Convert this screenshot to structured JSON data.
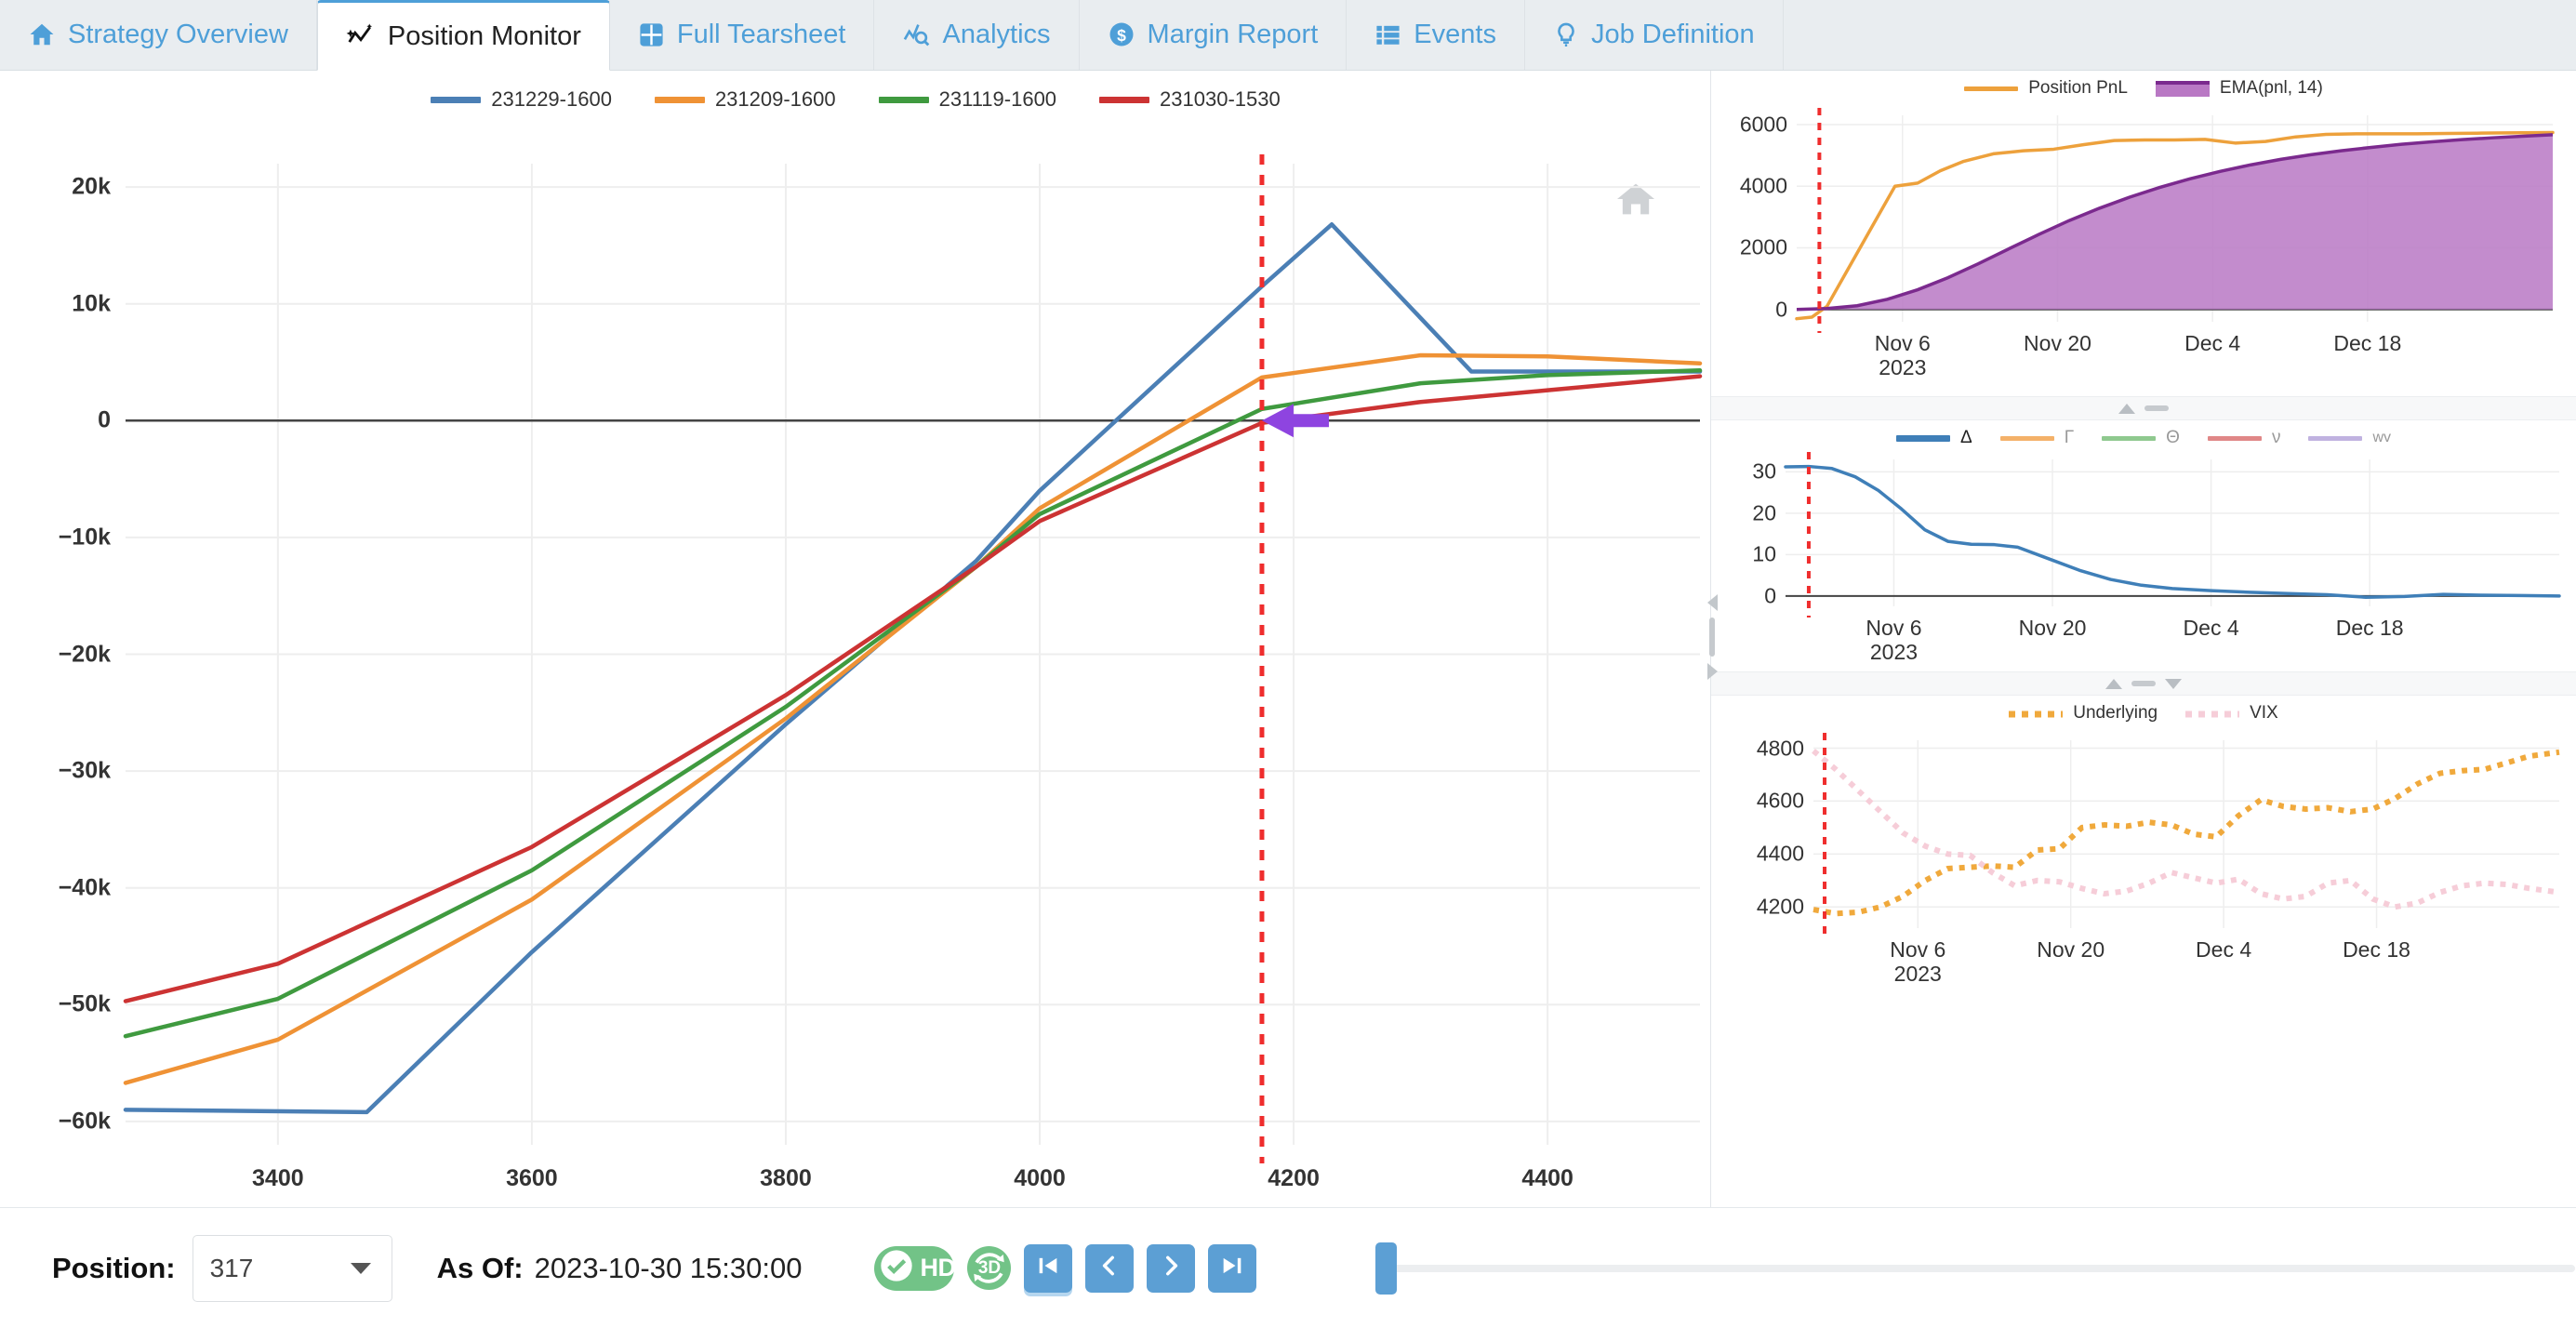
{
  "tabs": [
    {
      "label": "Strategy Overview",
      "icon": "home-icon",
      "active": false
    },
    {
      "label": "Position Monitor",
      "icon": "trend-sparkle-icon",
      "active": true
    },
    {
      "label": "Full Tearsheet",
      "icon": "grid-icon",
      "active": false
    },
    {
      "label": "Analytics",
      "icon": "analytics-magnify-icon",
      "active": false
    },
    {
      "label": "Margin Report",
      "icon": "dollar-circle-icon",
      "active": false
    },
    {
      "label": "Events",
      "icon": "list-icon",
      "active": false
    },
    {
      "label": "Job Definition",
      "icon": "lightbulb-icon",
      "active": false
    }
  ],
  "colors": {
    "tab_blue": "#4e9fd8",
    "series_blue": "#4b7fb5",
    "series_orange": "#ef9235",
    "series_green": "#3f9a3f",
    "series_red": "#cc3333",
    "marker_red": "#ef2d2d",
    "arrow_purple": "#8e44e0",
    "pnl_orange": "#eda13c",
    "ema_purple_fill": "#b978c4",
    "ema_purple_line": "#7b2a8e",
    "greek_delta": "#3f7fb8",
    "greek_gamma": "#f4b169",
    "greek_theta": "#8fc98f",
    "greek_vega": "#e08787",
    "greek_wv": "#c0b2e0",
    "underlying_orange": "#f0a93c",
    "vix_pink": "#f6cdd8",
    "green_toggle": "#72c387",
    "nav_blue": "#5c9fd4"
  },
  "main_chart": {
    "home_icon": "home-reset-icon",
    "legend": [
      {
        "label": "231229-1600",
        "color": "#4b7fb5"
      },
      {
        "label": "231209-1600",
        "color": "#ef9235"
      },
      {
        "label": "231119-1600",
        "color": "#3f9a3f"
      },
      {
        "label": "231030-1530",
        "color": "#cc3333"
      }
    ],
    "chart_data": {
      "type": "line",
      "title": "",
      "xlabel": "",
      "ylabel": "",
      "xlim": [
        3280,
        4520
      ],
      "ylim": [
        -62000,
        22000
      ],
      "yticks": [
        "20k",
        "10k",
        "0",
        "−10k",
        "−20k",
        "−30k",
        "−40k",
        "−50k",
        "−60k"
      ],
      "ytick_values": [
        20000,
        10000,
        0,
        -10000,
        -20000,
        -30000,
        -40000,
        -50000,
        -60000
      ],
      "xticks": [
        "3400",
        "3600",
        "3800",
        "4000",
        "4200",
        "4400"
      ],
      "xtick_values": [
        3400,
        3600,
        3800,
        4000,
        4200,
        4400
      ],
      "grid": true,
      "zero_line": true,
      "marker_line_x": 4175,
      "marker_arrow_y": 0,
      "legend_position": "top-center",
      "series": [
        {
          "name": "231229-1600",
          "color": "#4b7fb5",
          "x": [
            3280,
            3470,
            3600,
            3800,
            3950,
            4000,
            4175,
            4230,
            4340,
            4400,
            4520
          ],
          "y": [
            -59000,
            -59200,
            -45500,
            -26000,
            -12000,
            -6000,
            11500,
            16800,
            4200,
            4200,
            4200
          ]
        },
        {
          "name": "231209-1600",
          "color": "#ef9235",
          "x": [
            3280,
            3400,
            3600,
            3800,
            3950,
            4000,
            4175,
            4300,
            4400,
            4520
          ],
          "y": [
            -56700,
            -53000,
            -41000,
            -25500,
            -12500,
            -7500,
            3700,
            5600,
            5500,
            4900
          ]
        },
        {
          "name": "231119-1600",
          "color": "#3f9a3f",
          "x": [
            3280,
            3400,
            3600,
            3800,
            3950,
            4000,
            4175,
            4300,
            4400,
            4520
          ],
          "y": [
            -52700,
            -49500,
            -38500,
            -24500,
            -12500,
            -8000,
            1000,
            3200,
            3900,
            4300
          ]
        },
        {
          "name": "231030-1530",
          "color": "#cc3333",
          "x": [
            3280,
            3400,
            3600,
            3800,
            3950,
            4000,
            4175,
            4300,
            4400,
            4520
          ],
          "y": [
            -49700,
            -46500,
            -36500,
            -23500,
            -12500,
            -8600,
            -200,
            1600,
            2600,
            3800
          ]
        }
      ]
    }
  },
  "pnl_panel": {
    "legend": [
      {
        "label": "Position PnL",
        "color": "#eda13c",
        "style": "line"
      },
      {
        "label": "EMA(pnl, 14)",
        "color": "#b978c4",
        "style": "area"
      }
    ],
    "chart_data": {
      "type": "area",
      "title": "",
      "yticks": [
        "0",
        "2000",
        "4000",
        "6000"
      ],
      "ytick_values": [
        0,
        2000,
        4000,
        6000
      ],
      "ylim": [
        -400,
        6300
      ],
      "xticks": [
        "Nov 6",
        "Nov 20",
        "Dec 4",
        "Dec 18"
      ],
      "xtick_sub": "2023",
      "grid": true,
      "marker_line_x": "2023-10-30",
      "series": [
        {
          "name": "Position PnL",
          "color": "#eda13c",
          "x": [
            0,
            2,
            4,
            7,
            10,
            13,
            16,
            19,
            22,
            26,
            30,
            34,
            38,
            42,
            46,
            50,
            54,
            58,
            62,
            66,
            70,
            74,
            78,
            82,
            86,
            90,
            94,
            100
          ],
          "y": [
            -300,
            -250,
            100,
            1400,
            2700,
            4000,
            4100,
            4500,
            4800,
            5050,
            5150,
            5200,
            5350,
            5480,
            5500,
            5500,
            5520,
            5400,
            5450,
            5600,
            5680,
            5700,
            5700,
            5700,
            5710,
            5720,
            5730,
            5740
          ]
        },
        {
          "name": "EMA(pnl, 14)",
          "color": "#b978c4",
          "x": [
            0,
            4,
            8,
            12,
            16,
            20,
            24,
            28,
            32,
            36,
            40,
            44,
            48,
            52,
            56,
            60,
            64,
            68,
            72,
            76,
            80,
            84,
            88,
            92,
            96,
            100
          ],
          "y": [
            0,
            30,
            120,
            330,
            640,
            1030,
            1480,
            1960,
            2430,
            2880,
            3280,
            3640,
            3960,
            4240,
            4480,
            4690,
            4870,
            5020,
            5150,
            5260,
            5360,
            5440,
            5510,
            5570,
            5620,
            5670
          ]
        }
      ]
    }
  },
  "greeks_panel": {
    "legend": [
      {
        "label": "Δ",
        "color": "#3f7fb8",
        "active": true
      },
      {
        "label": "Γ",
        "color": "#f4b169",
        "active": false
      },
      {
        "label": "Θ",
        "color": "#8fc98f",
        "active": false
      },
      {
        "label": "ν",
        "color": "#e08787",
        "active": false
      },
      {
        "label": "wv",
        "color": "#c0b2e0",
        "active": false
      }
    ],
    "chart_data": {
      "type": "line",
      "yticks": [
        "0",
        "10",
        "20",
        "30"
      ],
      "ytick_values": [
        0,
        10,
        20,
        30
      ],
      "ylim": [
        -2.5,
        33
      ],
      "xticks": [
        "Nov 6",
        "Nov 20",
        "Dec 4",
        "Dec 18"
      ],
      "xtick_sub": "2023",
      "grid": true,
      "marker_line_x": "2023-10-30",
      "series": [
        {
          "name": "Δ",
          "color": "#3f7fb8",
          "x": [
            0,
            3,
            6,
            9,
            12,
            15,
            18,
            21,
            24,
            27,
            30,
            34,
            38,
            42,
            46,
            50,
            55,
            60,
            65,
            70,
            75,
            80,
            85,
            90,
            95,
            100
          ],
          "y": [
            31.2,
            31.3,
            30.8,
            28.8,
            25.5,
            21.0,
            16.0,
            13.2,
            12.5,
            12.4,
            11.8,
            9.0,
            6.2,
            4.0,
            2.6,
            1.8,
            1.3,
            0.9,
            0.6,
            0.3,
            -0.3,
            -0.1,
            0.4,
            0.2,
            0.1,
            0.0
          ]
        }
      ]
    }
  },
  "market_panel": {
    "legend": [
      {
        "label": "Underlying",
        "color": "#f0a93c",
        "style": "dotted"
      },
      {
        "label": "VIX",
        "color": "#f6cdd8",
        "style": "dotted"
      }
    ],
    "chart_data": {
      "type": "line",
      "yticks": [
        "4200",
        "4400",
        "4600",
        "4800"
      ],
      "ytick_values": [
        4200,
        4400,
        4600,
        4800
      ],
      "ylim": [
        4120,
        4830
      ],
      "xticks": [
        "Nov 6",
        "Nov 20",
        "Dec 4",
        "Dec 18"
      ],
      "xtick_sub": "2023",
      "grid": true,
      "marker_line_x": "2023-10-30",
      "series": [
        {
          "name": "Underlying",
          "color": "#f0a93c",
          "x": [
            0,
            3,
            6,
            9,
            12,
            15,
            18,
            21,
            24,
            27,
            30,
            33,
            36,
            39,
            42,
            45,
            48,
            51,
            54,
            57,
            60,
            63,
            66,
            69,
            72,
            75,
            78,
            81,
            84,
            87,
            90,
            93,
            96,
            100
          ],
          "y": [
            4190,
            4175,
            4180,
            4200,
            4240,
            4300,
            4345,
            4350,
            4355,
            4350,
            4415,
            4420,
            4500,
            4510,
            4505,
            4520,
            4510,
            4475,
            4465,
            4545,
            4605,
            4580,
            4570,
            4575,
            4560,
            4570,
            4610,
            4665,
            4705,
            4715,
            4720,
            4745,
            4770,
            4785
          ]
        },
        {
          "name": "VIX",
          "color": "#f6cdd8",
          "x": [
            0,
            3,
            6,
            9,
            12,
            15,
            18,
            21,
            24,
            27,
            30,
            33,
            36,
            39,
            42,
            45,
            48,
            51,
            54,
            57,
            60,
            63,
            66,
            69,
            72,
            75,
            78,
            81,
            84,
            87,
            90,
            93,
            96,
            100
          ],
          "y": [
            4790,
            4720,
            4640,
            4560,
            4480,
            4430,
            4400,
            4395,
            4330,
            4280,
            4300,
            4295,
            4270,
            4250,
            4260,
            4290,
            4330,
            4310,
            4290,
            4305,
            4250,
            4230,
            4240,
            4290,
            4300,
            4230,
            4200,
            4215,
            4255,
            4280,
            4290,
            4285,
            4270,
            4255
          ]
        }
      ]
    }
  },
  "bottom_bar": {
    "position_label": "Position:",
    "position_value": "317",
    "asof_label": "As Of:",
    "asof_value": "2023-10-30 15:30:00",
    "hd_label": "HD",
    "hd_icon": "check-circle-icon",
    "threed_label": "3D",
    "threed_icon": "rotate-3d-icon",
    "nav_first": "skip-to-start-icon",
    "nav_prev": "step-back-icon",
    "nav_next": "step-forward-icon",
    "nav_last": "skip-to-end-icon",
    "slider_name": "timeline-slider",
    "slider_value": 0
  }
}
